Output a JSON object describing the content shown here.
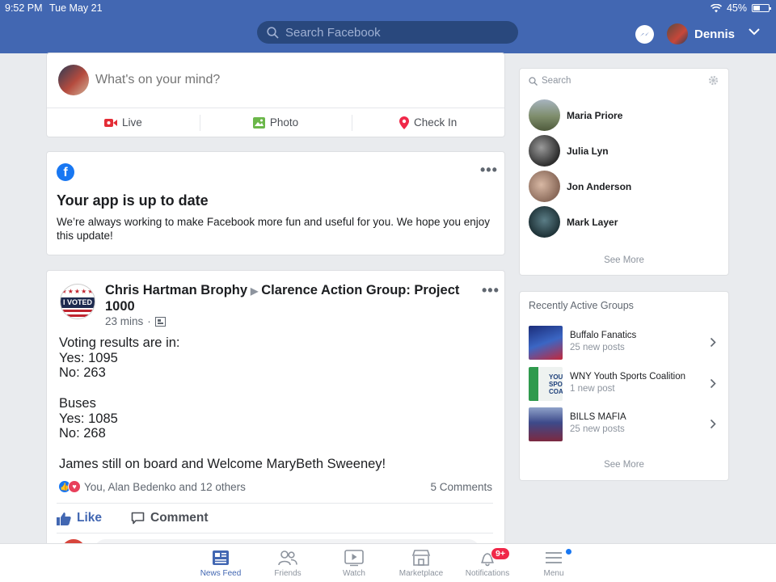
{
  "status_bar": {
    "time": "9:52 PM",
    "date": "Tue May 21",
    "battery_percent": "45%",
    "battery_level": 0.45
  },
  "header": {
    "search_placeholder": "Search Facebook",
    "user_name": "Dennis",
    "brand_color": "#4267b2"
  },
  "composer": {
    "placeholder": "What's on your mind?",
    "actions": [
      {
        "label": "Live",
        "icon": "live-video-icon",
        "color": "#e42d36"
      },
      {
        "label": "Photo",
        "icon": "photo-icon",
        "color": "#6bb74a"
      },
      {
        "label": "Check In",
        "icon": "location-pin-icon",
        "color": "#f02849"
      }
    ]
  },
  "update_card": {
    "title": "Your app is up to date",
    "message": "We’re always working to make Facebook more fun and useful for you. We hope you enjoy this update!"
  },
  "post": {
    "author": "Chris Hartman Brophy",
    "group": "Clarence Action Group: Project 1000",
    "time": "23 mins",
    "avatar_text": "I VOTED",
    "lines": [
      "Voting results are in:",
      "Yes: 1095",
      "No: 263",
      "",
      "Buses",
      "Yes: 1085",
      "No: 268",
      "",
      "James still on board and Welcome MaryBeth Sweeney!"
    ],
    "reactions_text": "You, Alan Bedenko and 12 others",
    "comments_count": "5 Comments",
    "like_label": "Like",
    "comment_label": "Comment"
  },
  "contacts": {
    "search_placeholder": "Search",
    "people": [
      {
        "name": "Maria Priore"
      },
      {
        "name": "Julia Lyn"
      },
      {
        "name": "Jon Anderson"
      },
      {
        "name": "Mark Layer"
      }
    ],
    "see_more": "See More"
  },
  "groups": {
    "title": "Recently Active Groups",
    "items": [
      {
        "name": "Buffalo Fanatics",
        "subtitle": "25 new posts"
      },
      {
        "name": "WNY Youth Sports Coalition",
        "subtitle": "1 new post",
        "thumb_text": "YOUT SPOR COALIT"
      },
      {
        "name": "BILLS MAFIA",
        "subtitle": "25 new posts"
      }
    ],
    "see_more": "See More"
  },
  "tabbar": {
    "tabs": [
      {
        "label": "News Feed",
        "icon": "news-feed-icon",
        "active": true
      },
      {
        "label": "Friends",
        "icon": "friends-icon"
      },
      {
        "label": "Watch",
        "icon": "watch-icon"
      },
      {
        "label": "Marketplace",
        "icon": "marketplace-icon"
      },
      {
        "label": "Notifications",
        "icon": "bell-icon",
        "badge": "9+"
      },
      {
        "label": "Menu",
        "icon": "menu-icon"
      }
    ]
  }
}
